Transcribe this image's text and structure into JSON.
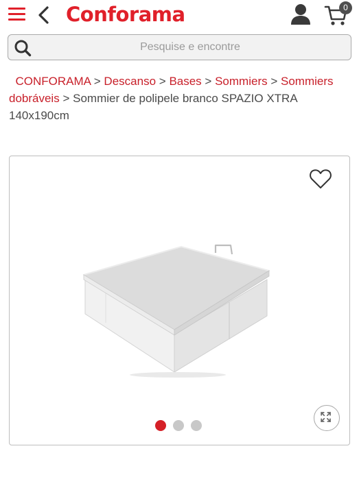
{
  "header": {
    "logo_text": "Conforama",
    "brand_color": "#e0202a",
    "cart_count": "0",
    "icons": [
      "menu-icon",
      "back-chevron-icon",
      "user-icon",
      "cart-icon"
    ]
  },
  "search": {
    "placeholder": "Pesquise e encontre",
    "value": ""
  },
  "breadcrumb": {
    "items": [
      "CONFORAMA",
      "Descanso",
      "Bases",
      "Sommiers",
      "Sommiers dobráveis"
    ],
    "separator": ">",
    "current": "Sommier de polipele branco SPAZIO XTRA 140x190cm"
  },
  "gallery": {
    "image_count": 3,
    "active_index": 0,
    "icons": [
      "heart-icon",
      "expand-icon"
    ],
    "active_dot_color": "#d52027"
  }
}
